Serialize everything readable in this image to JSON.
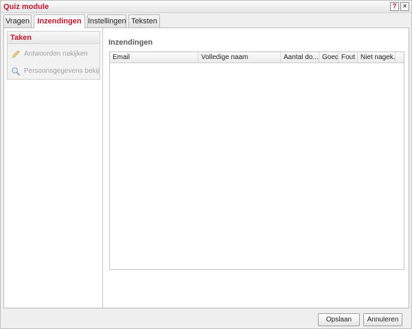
{
  "window": {
    "title": "Quiz module",
    "help_label": "?",
    "close_label": "×"
  },
  "tabs": [
    {
      "label": "Vragen",
      "active": false
    },
    {
      "label": "Inzendingen",
      "active": true
    },
    {
      "label": "Instellingen",
      "active": false
    },
    {
      "label": "Teksten",
      "active": false
    }
  ],
  "sidebar": {
    "header": "Taken",
    "items": [
      {
        "label": "Antwoorden nakijken",
        "icon": "pencil-icon",
        "enabled": false
      },
      {
        "label": "Persoonsgegevens bekijken",
        "icon": "magnifier-icon",
        "enabled": false
      }
    ]
  },
  "main": {
    "section_title": "Inzendingen",
    "grid": {
      "columns": [
        "Email",
        "Volledige naam",
        "Aantal do...",
        "Goed",
        "Fout",
        "Niet nagek..."
      ],
      "rows": []
    }
  },
  "footer": {
    "save_label": "Opslaan",
    "cancel_label": "Annuleren"
  },
  "colors": {
    "accent": "#c0142c",
    "disabled_text": "#a2a2a2"
  }
}
